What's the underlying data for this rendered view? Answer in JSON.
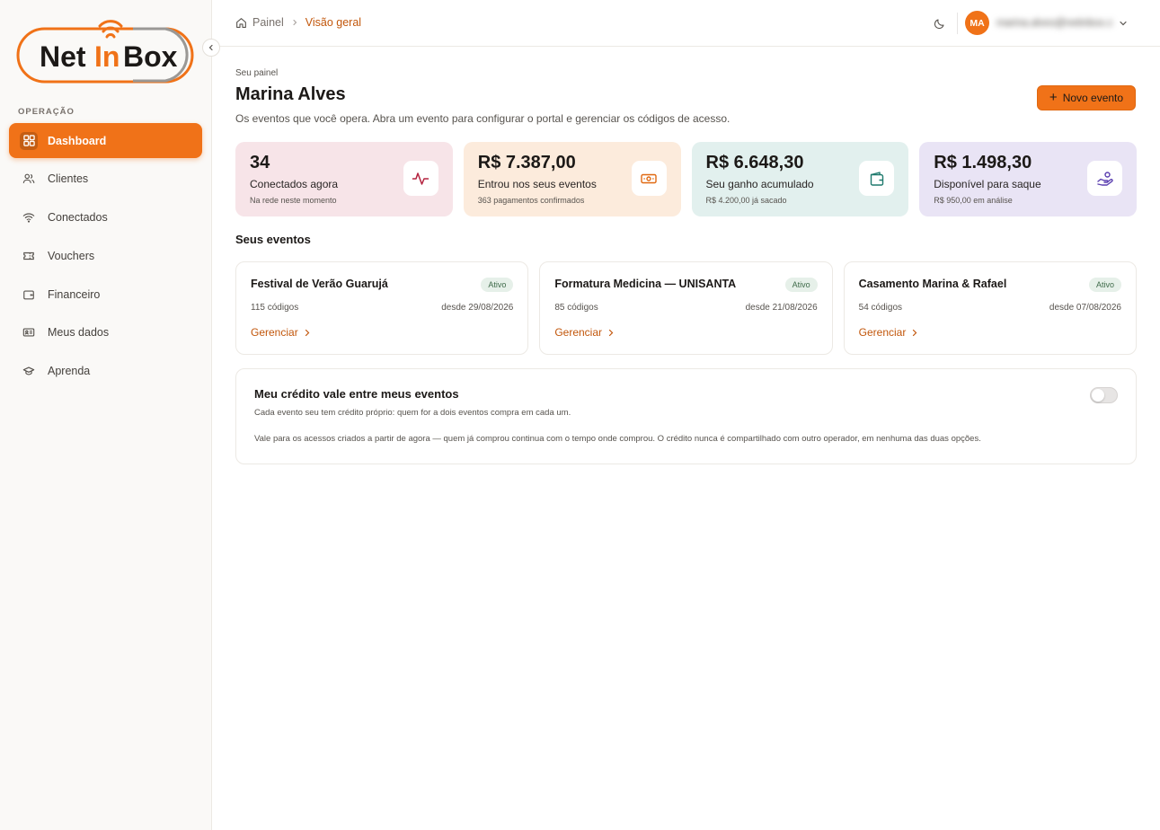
{
  "brand": {
    "logo_text_a": "Net",
    "logo_text_b": "In",
    "logo_text_c": "Box",
    "accent": "#f07218"
  },
  "sidebar": {
    "section": "OPERAÇÃO",
    "items": [
      {
        "label": "Dashboard",
        "icon": "grid-icon",
        "active": true
      },
      {
        "label": "Clientes",
        "icon": "users-icon"
      },
      {
        "label": "Conectados",
        "icon": "wifi-icon"
      },
      {
        "label": "Vouchers",
        "icon": "ticket-icon"
      },
      {
        "label": "Financeiro",
        "icon": "wallet-icon"
      },
      {
        "label": "Meus dados",
        "icon": "id-card-icon"
      },
      {
        "label": "Aprenda",
        "icon": "graduation-cap-icon"
      }
    ]
  },
  "topbar": {
    "breadcrumb": {
      "root": "Painel",
      "current": "Visão geral"
    },
    "user": {
      "initials": "MA",
      "email": "marina.alves@netinbox.com"
    }
  },
  "header": {
    "kicker": "Seu painel",
    "title": "Marina Alves",
    "subtitle": "Os eventos que você opera. Abra um evento para configurar o portal e gerenciar os códigos de acesso.",
    "new_event_label": "Novo evento"
  },
  "stats": [
    {
      "value": "34",
      "label": "Conectados agora",
      "hint": "Na rede neste momento",
      "icon": "activity-icon",
      "color": "#b4233f"
    },
    {
      "value": "R$ 7.387,00",
      "label": "Entrou nos seus eventos",
      "hint": "363 pagamentos confirmados",
      "icon": "banknote-icon",
      "color": "#e06810"
    },
    {
      "value": "R$ 6.648,30",
      "label": "Seu ganho acumulado",
      "hint": "R$ 4.200,00 já sacado",
      "icon": "wallet-icon",
      "color": "#1f7a6e"
    },
    {
      "value": "R$ 1.498,30",
      "label": "Disponível para saque",
      "hint": "R$ 950,00 em análise",
      "icon": "hand-coins-icon",
      "color": "#5b3fb0"
    }
  ],
  "events_section": {
    "title": "Seus eventos"
  },
  "events": [
    {
      "name": "Festival de Verão Guarujá",
      "status": "Ativo",
      "codes": "115 códigos",
      "since": "desde 29/08/2026",
      "action": "Gerenciar"
    },
    {
      "name": "Formatura Medicina — UNISANTA",
      "status": "Ativo",
      "codes": "85 códigos",
      "since": "desde 21/08/2026",
      "action": "Gerenciar"
    },
    {
      "name": "Casamento Marina & Rafael",
      "status": "Ativo",
      "codes": "54 códigos",
      "since": "desde 07/08/2026",
      "action": "Gerenciar"
    }
  ],
  "credit": {
    "title": "Meu crédito vale entre meus eventos",
    "description": "Cada evento seu tem crédito próprio: quem for a dois eventos compra em cada um.",
    "note": "Vale para os acessos criados a partir de agora — quem já comprou continua com o tempo onde comprou. O crédito nunca é compartilhado com outro operador, em nenhuma das duas opções.",
    "enabled": false
  }
}
